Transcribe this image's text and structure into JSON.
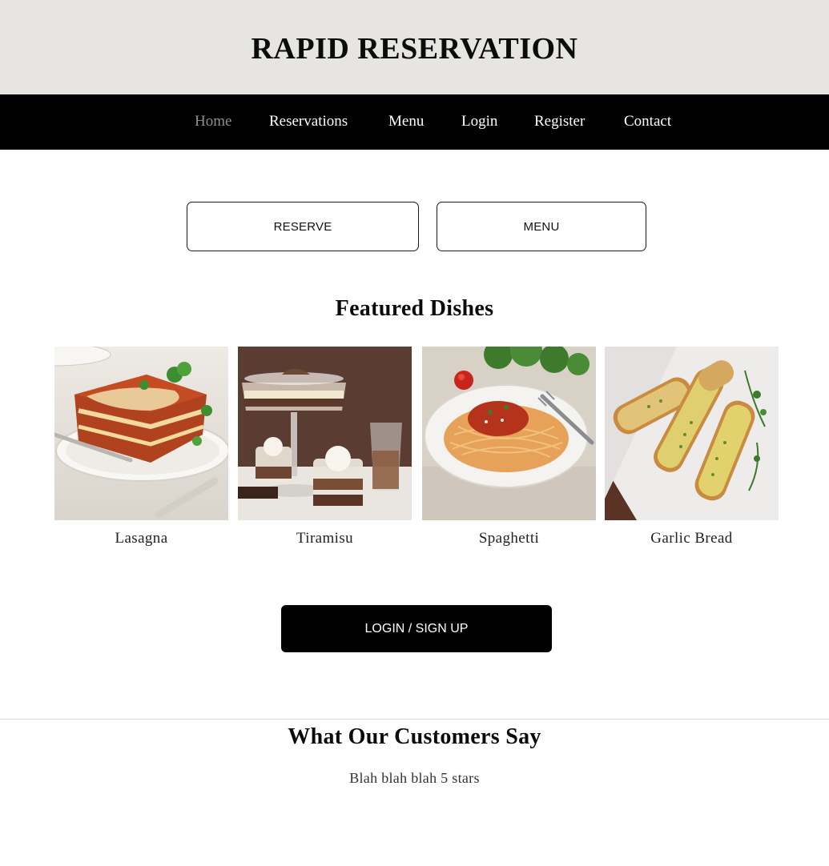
{
  "header": {
    "title": "RAPID RESERVATION"
  },
  "nav": {
    "items": [
      {
        "label": "Home",
        "active": true
      },
      {
        "label": "Reservations",
        "active": false
      },
      {
        "label": "Menu",
        "active": false
      },
      {
        "label": "Login",
        "active": false
      },
      {
        "label": "Register",
        "active": false
      },
      {
        "label": "Contact",
        "active": false
      }
    ]
  },
  "actions": {
    "reserve_label": "RESERVE",
    "menu_label": "MENU"
  },
  "featured": {
    "heading": "Featured Dishes",
    "dishes": [
      {
        "name": "Lasagna",
        "icon": "lasagna-photo"
      },
      {
        "name": "Tiramisu",
        "icon": "tiramisu-photo"
      },
      {
        "name": "Spaghetti",
        "icon": "spaghetti-photo"
      },
      {
        "name": "Garlic Bread",
        "icon": "garlic-bread-photo"
      }
    ]
  },
  "cta": {
    "login_label": "LOGIN / SIGN UP"
  },
  "testimonials": {
    "heading": "What Our Customers Say",
    "quote": "Blah blah blah 5 stars"
  },
  "colors": {
    "header_bg": "#e6e5e1",
    "nav_bg": "#000000",
    "nav_active": "#8f8f8f",
    "accent": "#000000"
  }
}
